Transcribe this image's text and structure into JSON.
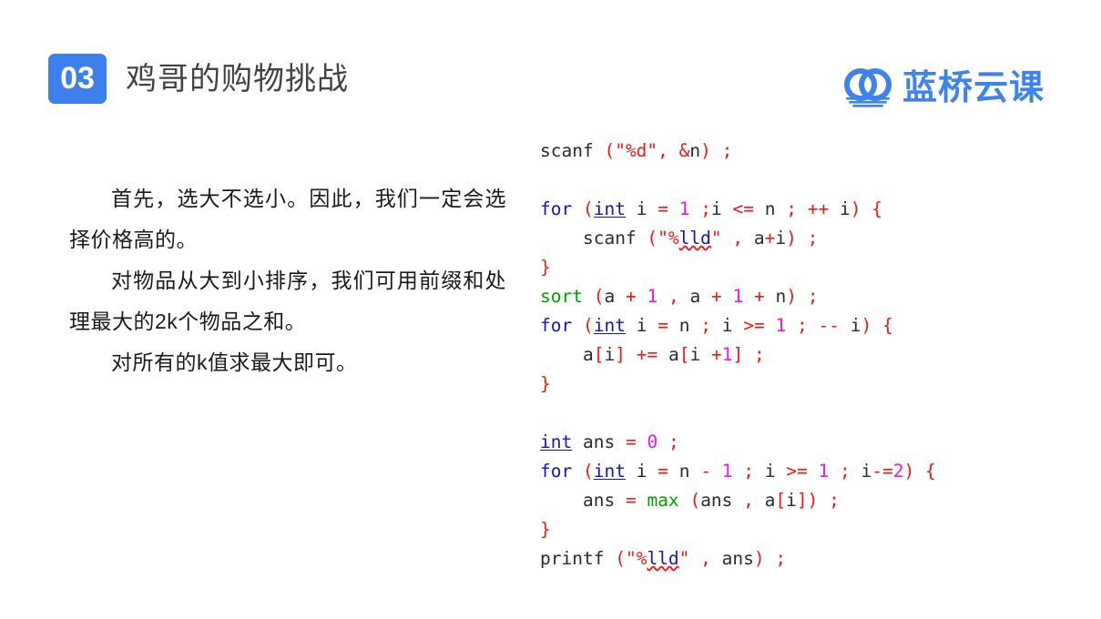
{
  "header": {
    "section_number": "03",
    "title": "鸡哥的购物挑战",
    "badge_color": "#3c7fed",
    "title_color": "#434343"
  },
  "brand": {
    "name": "蓝桥云课",
    "icon": "interlocking-rings-water-logo",
    "color": "#3c83ef"
  },
  "explanation": {
    "paragraphs": [
      "首先，选大不选小。因此，我们一定会选择价格高的。",
      "对物品从大到小排序，我们可用前缀和处理最大的2k个物品之和。",
      "对所有的k值求最大即可。"
    ]
  },
  "code": {
    "language": "C++",
    "colors": {
      "keyword": "#1414c8",
      "function": "#00a000",
      "punctuation": "#fa1414",
      "string": "#fa1414",
      "number": "#ee14ee",
      "plain": "#2b2b2b"
    },
    "lines": [
      {
        "id": "l1",
        "text": "scanf (\"%d\", &n) ;"
      },
      {
        "id": "l2",
        "text": ""
      },
      {
        "id": "l3",
        "text": "for (int i = 1 ;i <= n ; ++ i) {"
      },
      {
        "id": "l4",
        "text": "    scanf (\"%lld\" , a+i) ;"
      },
      {
        "id": "l5",
        "text": "}"
      },
      {
        "id": "l6",
        "text": "sort (a + 1 , a + 1 + n) ;"
      },
      {
        "id": "l7",
        "text": "for (int i = n ; i >= 1 ; -- i) {"
      },
      {
        "id": "l8",
        "text": "    a[i] += a[i +1] ;"
      },
      {
        "id": "l9",
        "text": "}"
      },
      {
        "id": "l10",
        "text": ""
      },
      {
        "id": "l11",
        "text": "int ans = 0 ;"
      },
      {
        "id": "l12",
        "text": "for (int i = n - 1 ; i >= 1 ; i-=2) {"
      },
      {
        "id": "l13",
        "text": "    ans = max (ans , a[i]) ;"
      },
      {
        "id": "l14",
        "text": "}"
      },
      {
        "id": "l15",
        "text": "printf (\"%lld\" , ans) ;"
      }
    ]
  }
}
